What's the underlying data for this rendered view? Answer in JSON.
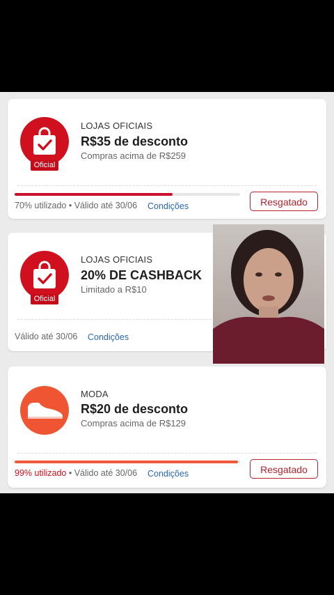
{
  "colors": {
    "brand_red": "#d0101f",
    "orange": "#ef5533",
    "link_blue": "#2a68b8",
    "progress_red": "#c8102e",
    "progress_orange": "#f05a3b"
  },
  "coupons": [
    {
      "icon": "shopping-bag-check-icon",
      "badge": "Oficial",
      "category": "LOJAS OFICIAIS",
      "title": "R$35 de desconto",
      "subtitle": "Compras acima de R$259",
      "progress": 0.7,
      "usage_text": "70% utilizado",
      "valid_text": "Válido até 30/06",
      "conditions_label": "Condições",
      "button_label": "Resgatado"
    },
    {
      "icon": "shopping-bag-check-icon",
      "badge": "Oficial",
      "category": "LOJAS OFICIAIS",
      "title": "20% DE CASHBACK",
      "subtitle": "Limitado a R$10",
      "valid_text": "Válido até 30/06",
      "conditions_label": "Condições"
    },
    {
      "icon": "sneaker-icon",
      "category": "MODA",
      "title": "R$20 de desconto",
      "subtitle": "Compras acima de R$129",
      "progress": 0.99,
      "usage_text": "99% utilizado",
      "valid_text": "Válido até 30/06",
      "conditions_label": "Condições",
      "button_label": "Resgatado"
    }
  ]
}
